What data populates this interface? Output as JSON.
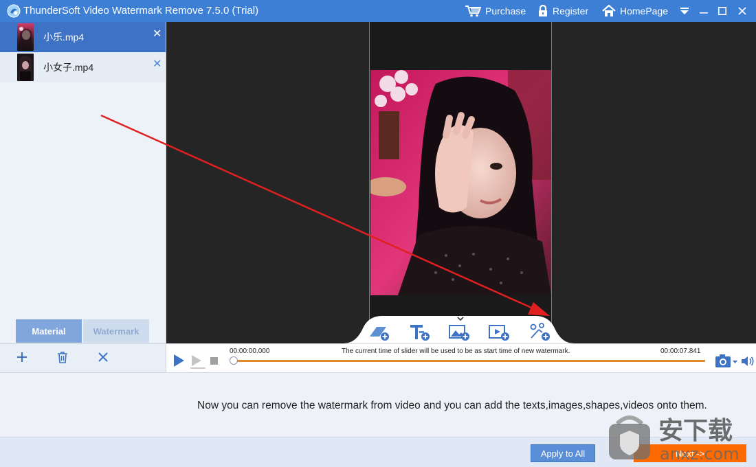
{
  "window": {
    "title": "ThunderSoft Video Watermark Remove 7.5.0 (Trial)",
    "purchase_label": "Purchase",
    "register_label": "Register",
    "homepage_label": "HomePage"
  },
  "files": [
    {
      "name": "小乐.mp4",
      "close": "✕"
    },
    {
      "name": "小女子.mp4",
      "close": "✕"
    }
  ],
  "tabs": {
    "material": "Material",
    "watermark": "Watermark"
  },
  "timeline": {
    "start_time": "00:00:00.000",
    "end_time": "00:00:07.841",
    "note": "The current time of slider will be used to be as start time of new watermark.",
    "progress": 0
  },
  "hint": "Now you can remove the watermark from video and you can add the texts,images,shapes,videos onto them.",
  "buttons": {
    "apply_all": "Apply to All",
    "next": "Next ->"
  },
  "watermark_logo": {
    "text_cn": "安下载",
    "text_url": "anxz.com"
  },
  "colors": {
    "accent": "#3d7fd5",
    "selected": "#3d72c4",
    "track": "#e38a2a",
    "next": "#ff6a00",
    "arrow": "#e02020"
  }
}
